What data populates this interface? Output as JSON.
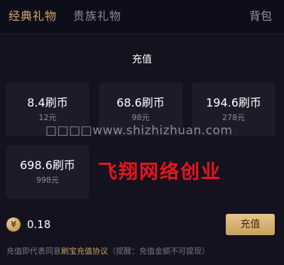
{
  "tabs": [
    {
      "label": "经典礼物",
      "active": true
    },
    {
      "label": "贵族礼物",
      "active": false
    }
  ],
  "bag_label": "背包",
  "section_title": "充值",
  "packages": [
    {
      "amount": "8.4刷币",
      "price": "12元"
    },
    {
      "amount": "68.6刷币",
      "price": "98元"
    },
    {
      "amount": "194.6刷币",
      "price": "278元"
    },
    {
      "amount": "698.6刷币",
      "price": "998元"
    }
  ],
  "watermark": {
    "url": "□□□□www.shizhizhuan.com",
    "text": "飞翔网络创业"
  },
  "balance": {
    "icon": "coin-icon",
    "icon_glyph": "¥",
    "value": "0.18"
  },
  "recharge_button": "充值",
  "agreement": {
    "prefix": "充值即代表同意",
    "link": "刷宝充值协议",
    "suffix": "（提醒：充值金额不可提现）"
  },
  "colors": {
    "accent_gold": "#d4ad6c",
    "watermark_red": "#e8141d",
    "background": "#14121f",
    "card": "#1d1b2a"
  }
}
